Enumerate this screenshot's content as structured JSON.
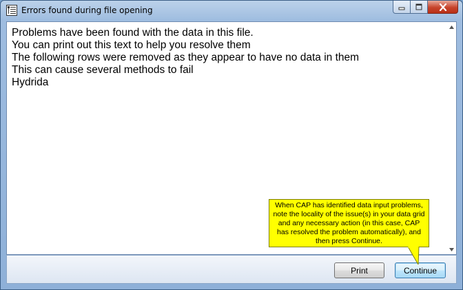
{
  "window": {
    "title": "Errors found during file opening"
  },
  "message": {
    "lines": [
      "Problems have been found with the data in this file.",
      "",
      "You can print out this text to help you resolve them",
      "",
      "",
      "The following rows were removed as they appear to have no data in them",
      "This can cause several methods to fail",
      "",
      "Hydrida"
    ]
  },
  "buttons": {
    "print_label": "Print",
    "continue_label": "Continue"
  },
  "tooltip": {
    "text": "When CAP has identified data input problems, note the locality of the issue(s) in your data grid and any necessary action (in this case, CAP has resolved the problem automatically), and then press Continue."
  },
  "icons": {
    "app": "app-window-icon",
    "minimize": "minimize-icon",
    "maximize": "maximize-icon",
    "close": "close-icon"
  },
  "colors": {
    "tooltip_bg": "#ffff00",
    "close_button": "#c7432b",
    "continue_button_border": "#3c7fb1"
  }
}
